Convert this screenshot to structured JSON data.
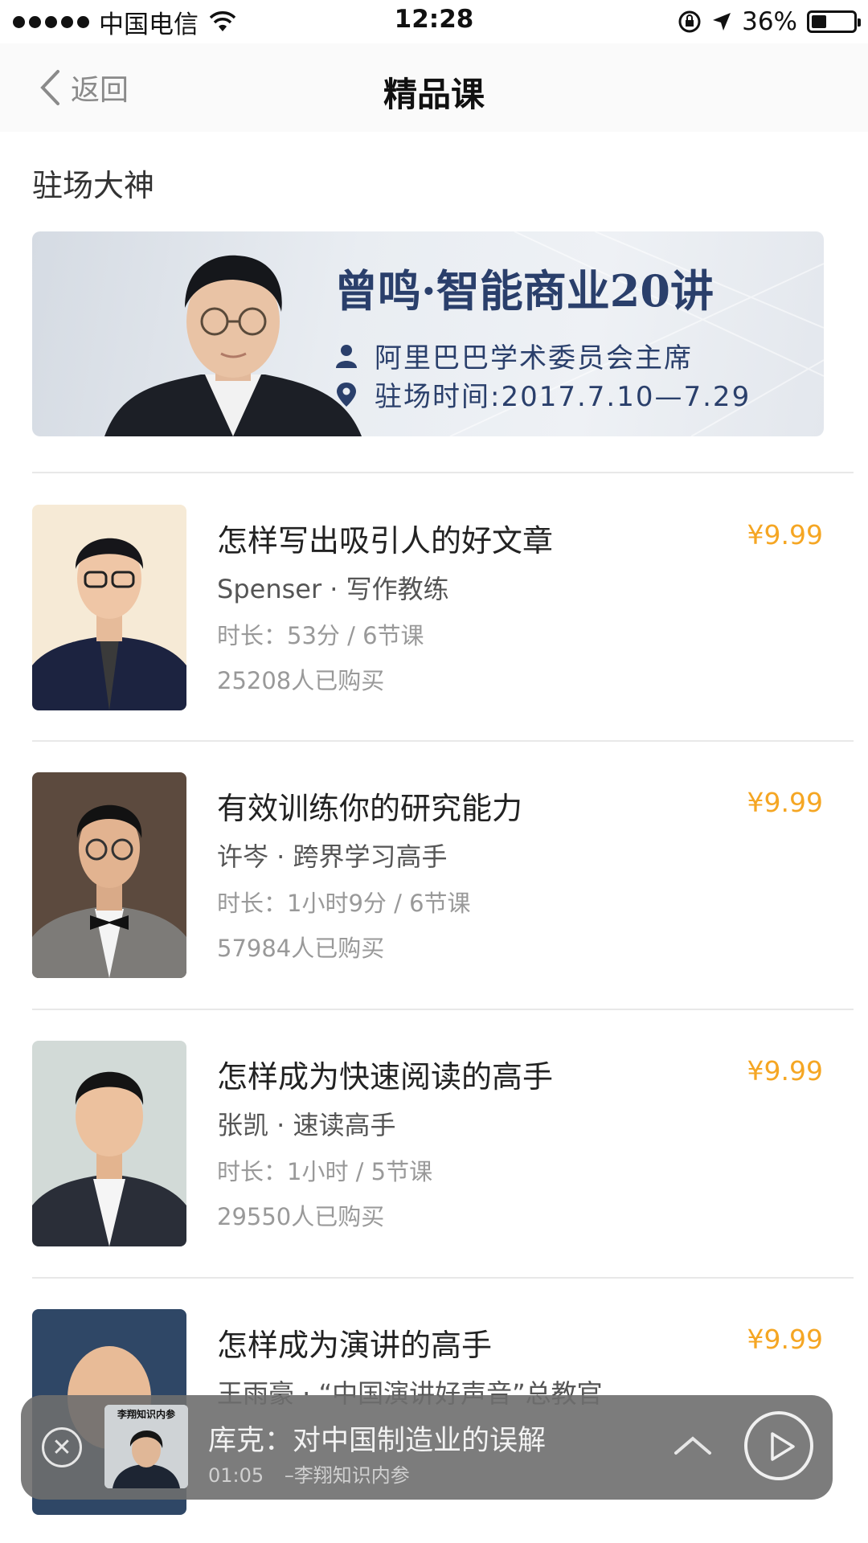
{
  "status_bar": {
    "carrier": "中国电信",
    "time": "12:28",
    "battery_text": "36%",
    "battery_level": 0.36
  },
  "nav": {
    "back_label": "返回",
    "title": "精品课"
  },
  "section": {
    "title": "驻场大神"
  },
  "banner": {
    "title": "曾鸣·智能商业20讲",
    "role": "阿里巴巴学术委员会主席",
    "period": "驻场时间:2017.7.10—7.29"
  },
  "courses": [
    {
      "title": "怎样写出吸引人的好文章",
      "price": "¥9.99",
      "author": "Spenser · 写作教练",
      "duration": "时长：53分 / 6节课",
      "buyers": "25208人已购买"
    },
    {
      "title": "有效训练你的研究能力",
      "price": "¥9.99",
      "author": "许岑 · 跨界学习高手",
      "duration": "时长：1小时9分 / 6节课",
      "buyers": "57984人已购买"
    },
    {
      "title": "怎样成为快速阅读的高手",
      "price": "¥9.99",
      "author": "张凯 · 速读高手",
      "duration": "时长：1小时 / 5节课",
      "buyers": "29550人已购买"
    },
    {
      "title": "怎样成为演讲的高手",
      "price": "¥9.99",
      "author": "王雨豪 · “中国演讲好声音”总教官"
    }
  ],
  "player": {
    "cover_label": "李翔知识内参",
    "title": "库克：对中国制造业的误解",
    "time": "01:05",
    "source": "–李翔知识内参"
  }
}
